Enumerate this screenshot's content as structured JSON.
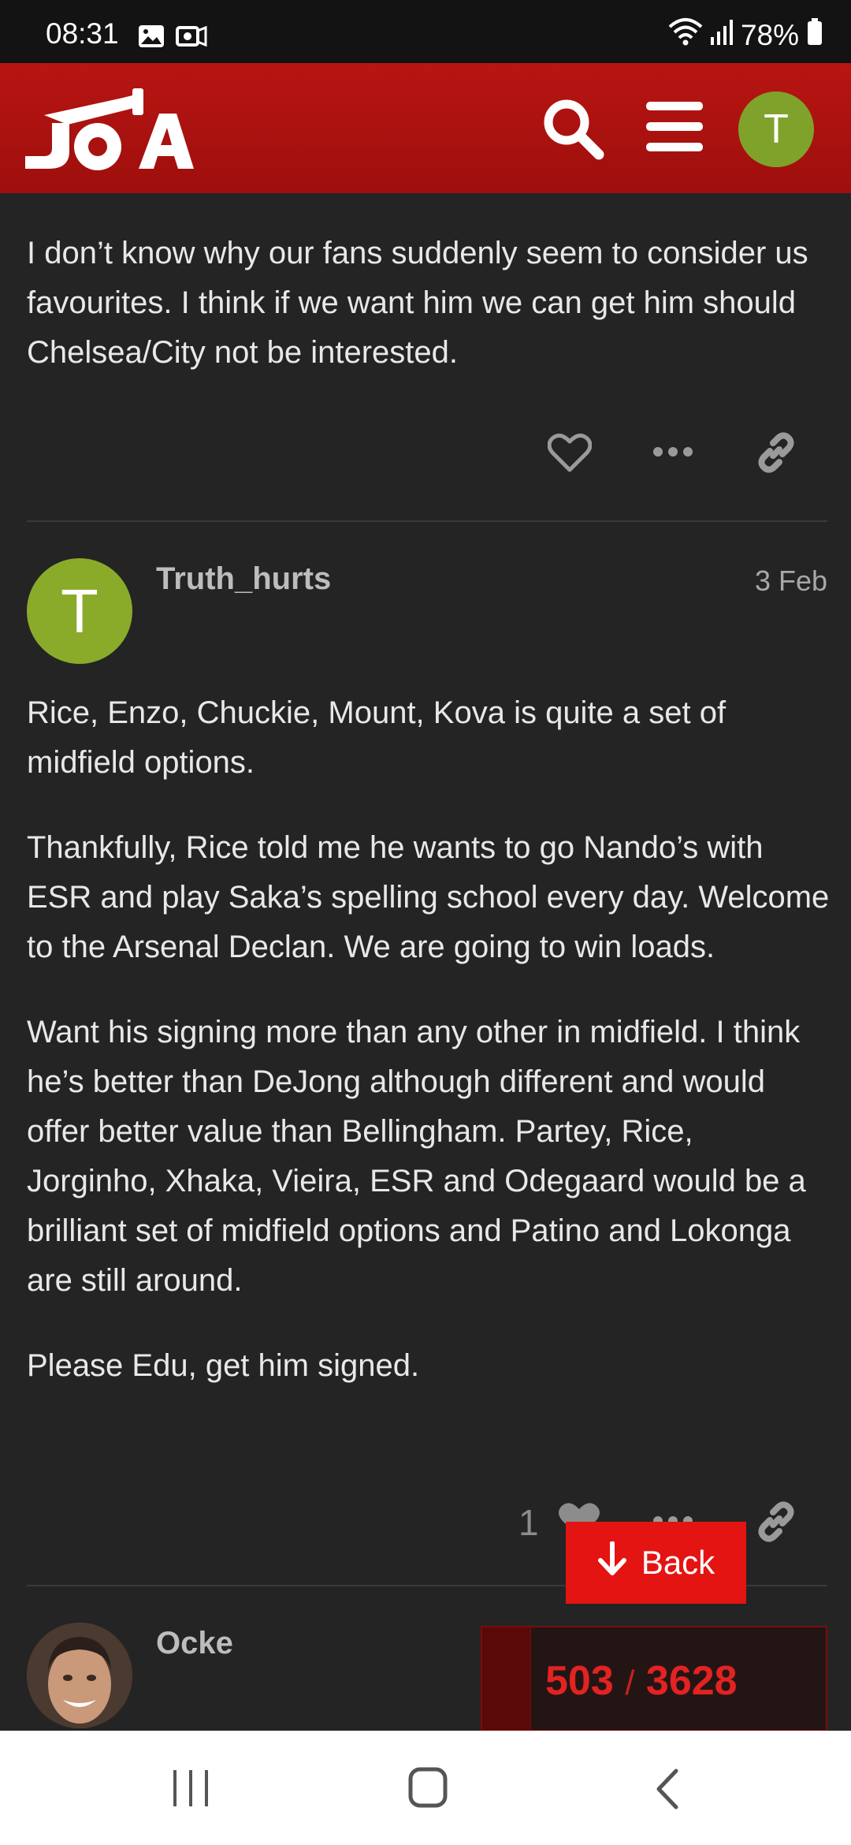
{
  "status_bar": {
    "time": "08:31",
    "battery": "78%",
    "icons_left": [
      "gallery-icon",
      "notification-icon"
    ],
    "icons_right": [
      "wifi-icon",
      "signal-icon",
      "battery-icon"
    ]
  },
  "header": {
    "logo_text": "JOA",
    "avatar_letter": "T",
    "brand_color": "#b71512"
  },
  "posts": [
    {
      "paragraphs": [
        "I don’t know why our fans suddenly seem to consider us favourites. I think if we want him we can get him should Chelsea/City not be interested."
      ]
    },
    {
      "username": "Truth_hurts",
      "avatar_letter": "T",
      "date": "3 Feb",
      "paragraphs": [
        "Rice, Enzo, Chuckie, Mount, Kova is quite a set of midfield options.",
        "Thankfully, Rice told me he wants to go Nando’s with ESR and play Saka’s spelling school every day. Welcome to the Arsenal Declan. We are going to win loads.",
        "Want his signing more than any other in midfield. I think he’s better than DeJong although different and would offer better value than Bellingham. Partey, Rice, Jorginho, Xhaka, Vieira, ESR and Odegaard would be a brilliant set of midfield options and Patino and Lokonga are still around.",
        "Please Edu, get him signed."
      ],
      "like_count": "1"
    },
    {
      "username": "Ocke"
    }
  ],
  "back_button": {
    "label": "Back"
  },
  "progress": {
    "current": "503",
    "separator": "/",
    "total": "3628",
    "fraction": 0.139
  },
  "nav_bar": {
    "icons": [
      "recent-apps-icon",
      "home-icon",
      "back-nav-icon"
    ]
  }
}
